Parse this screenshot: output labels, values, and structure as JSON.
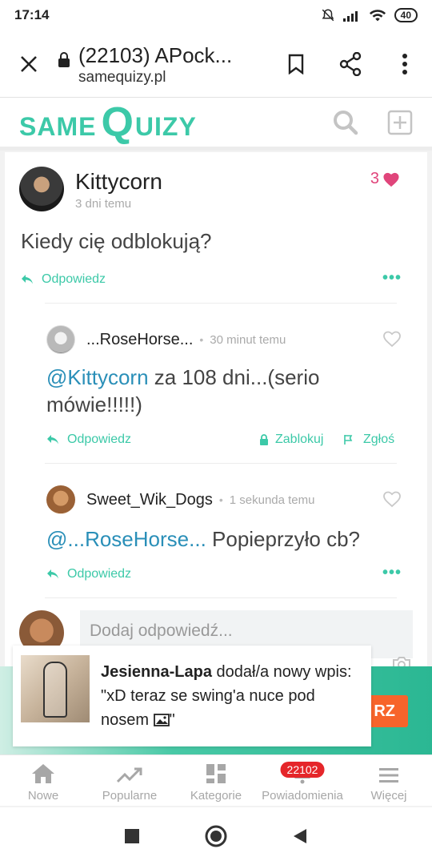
{
  "status_bar": {
    "time": "17:14",
    "battery": "40"
  },
  "browser": {
    "tab_title": "(22103) APock...",
    "domain": "samequizy.pl",
    "close_icon": "close-icon",
    "bookmark_icon": "bookmark-icon",
    "share_icon": "share-icon",
    "menu_icon": "more-vert-icon"
  },
  "site": {
    "logo_same": "SAME",
    "logo_q": "Q",
    "logo_uizy": "UIZY",
    "brand_color": "#3cc9a8"
  },
  "post": {
    "author": "Kittycorn",
    "time": "3 dni temu",
    "likes": "3",
    "text": "Kiedy cię odblokują?",
    "reply_label": "Odpowiedz"
  },
  "replies": [
    {
      "author": "...RoseHorse...",
      "time": "30 minut temu",
      "mention": "@Kittycorn",
      "text": " za 108 dni...(serio mówie!!!!!)",
      "reply_label": "Odpowiedz",
      "block_label": "Zablokuj",
      "report_label": "Zgłoś"
    },
    {
      "author": "Sweet_Wik_Dogs",
      "time": "1 sekunda temu",
      "mention": "@...RoseHorse...",
      "text": " Popieprzyło cb?",
      "reply_label": "Odpowiedz"
    }
  ],
  "compose": {
    "placeholder": "Dodaj odpowiedź..."
  },
  "banner": {
    "button_label": "RZ",
    "button_color": "#f7642b"
  },
  "toast": {
    "user": "Jesienna-Lapa",
    "action": " dodał/a nowy wpis:",
    "message": "\"xD teraz se swing'a nuce pod nosem ",
    "message_end": "\""
  },
  "bottom_nav": {
    "items": [
      {
        "label": "Nowe",
        "icon": "home-icon"
      },
      {
        "label": "Popularne",
        "icon": "trending-icon"
      },
      {
        "label": "Kategorie",
        "icon": "dashboard-icon"
      },
      {
        "label": "Powiadomienia",
        "icon": "notification-icon",
        "badge": "22102"
      },
      {
        "label": "Więcej",
        "icon": "menu-icon"
      }
    ]
  }
}
